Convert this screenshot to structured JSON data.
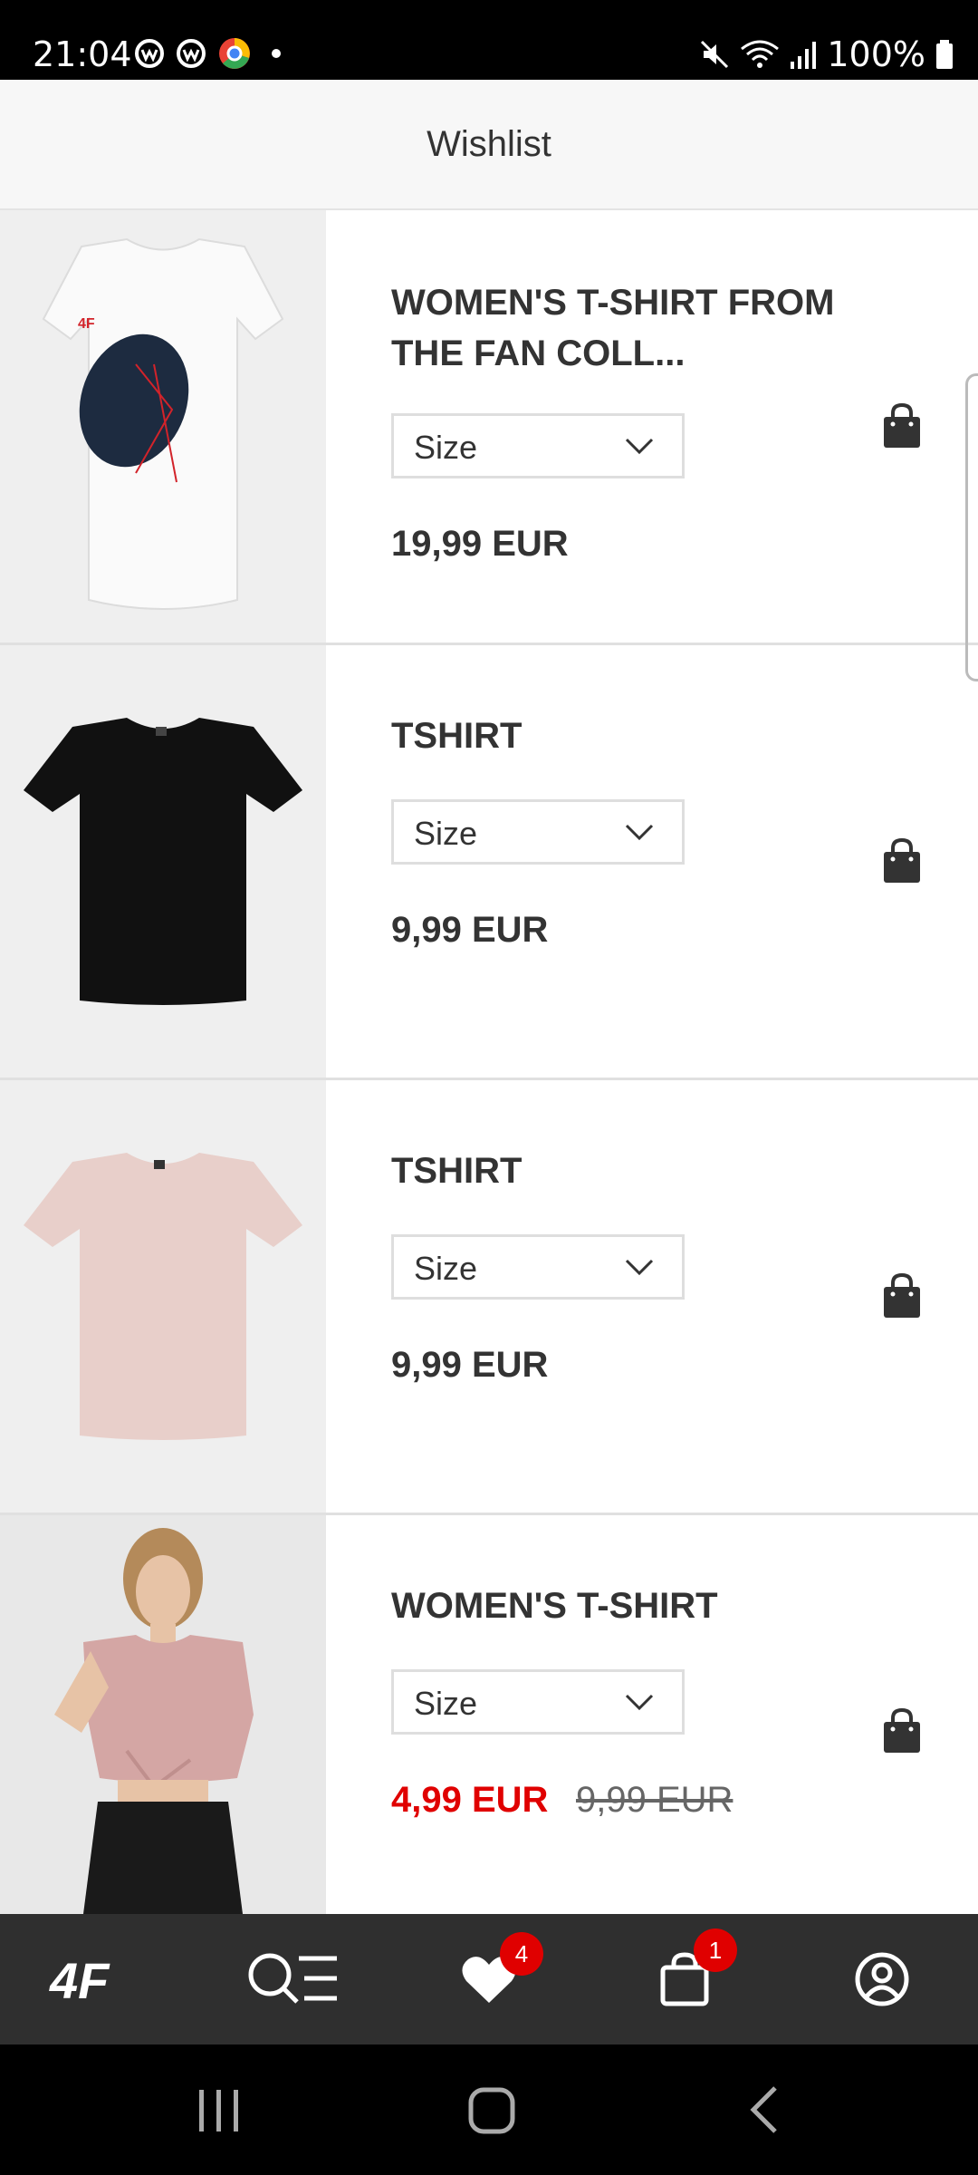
{
  "status_bar": {
    "time": "21:04",
    "battery": "100%"
  },
  "header": {
    "title": "Wishlist"
  },
  "items": [
    {
      "name": "WOMEN'S T-SHIRT FROM THE FAN COLL...",
      "size_placeholder": "Size",
      "price": "19,99 EUR",
      "shirt_color": "#ffffff"
    },
    {
      "name": "TSHIRT",
      "size_placeholder": "Size",
      "price": "9,99 EUR",
      "shirt_color": "#111111"
    },
    {
      "name": "TSHIRT",
      "size_placeholder": "Size",
      "price": "9,99 EUR",
      "shirt_color": "#e8cfca"
    },
    {
      "name": "WOMEN'S T-SHIRT",
      "size_placeholder": "Size",
      "sale_price": "4,99 EUR",
      "old_price": "9,99 EUR",
      "shirt_color": "#d4a6a4"
    }
  ],
  "bottom_nav": {
    "logo": "4F",
    "wishlist_count": "4",
    "cart_count": "1"
  },
  "colors": {
    "accent": "#e00000",
    "nav_bg": "#2f2f2f"
  }
}
